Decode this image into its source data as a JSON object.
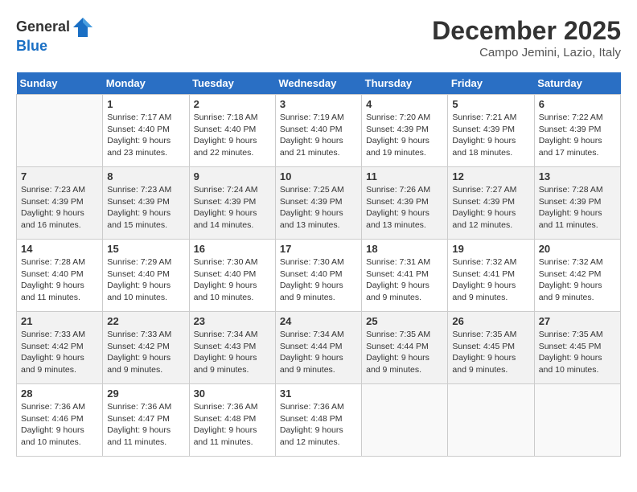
{
  "logo": {
    "general": "General",
    "blue": "Blue"
  },
  "title": "December 2025",
  "location": "Campo Jemini, Lazio, Italy",
  "days_of_week": [
    "Sunday",
    "Monday",
    "Tuesday",
    "Wednesday",
    "Thursday",
    "Friday",
    "Saturday"
  ],
  "weeks": [
    [
      {
        "day": "",
        "info": ""
      },
      {
        "day": "1",
        "info": "Sunrise: 7:17 AM\nSunset: 4:40 PM\nDaylight: 9 hours\nand 23 minutes."
      },
      {
        "day": "2",
        "info": "Sunrise: 7:18 AM\nSunset: 4:40 PM\nDaylight: 9 hours\nand 22 minutes."
      },
      {
        "day": "3",
        "info": "Sunrise: 7:19 AM\nSunset: 4:40 PM\nDaylight: 9 hours\nand 21 minutes."
      },
      {
        "day": "4",
        "info": "Sunrise: 7:20 AM\nSunset: 4:39 PM\nDaylight: 9 hours\nand 19 minutes."
      },
      {
        "day": "5",
        "info": "Sunrise: 7:21 AM\nSunset: 4:39 PM\nDaylight: 9 hours\nand 18 minutes."
      },
      {
        "day": "6",
        "info": "Sunrise: 7:22 AM\nSunset: 4:39 PM\nDaylight: 9 hours\nand 17 minutes."
      }
    ],
    [
      {
        "day": "7",
        "info": "Sunrise: 7:23 AM\nSunset: 4:39 PM\nDaylight: 9 hours\nand 16 minutes."
      },
      {
        "day": "8",
        "info": "Sunrise: 7:23 AM\nSunset: 4:39 PM\nDaylight: 9 hours\nand 15 minutes."
      },
      {
        "day": "9",
        "info": "Sunrise: 7:24 AM\nSunset: 4:39 PM\nDaylight: 9 hours\nand 14 minutes."
      },
      {
        "day": "10",
        "info": "Sunrise: 7:25 AM\nSunset: 4:39 PM\nDaylight: 9 hours\nand 13 minutes."
      },
      {
        "day": "11",
        "info": "Sunrise: 7:26 AM\nSunset: 4:39 PM\nDaylight: 9 hours\nand 13 minutes."
      },
      {
        "day": "12",
        "info": "Sunrise: 7:27 AM\nSunset: 4:39 PM\nDaylight: 9 hours\nand 12 minutes."
      },
      {
        "day": "13",
        "info": "Sunrise: 7:28 AM\nSunset: 4:39 PM\nDaylight: 9 hours\nand 11 minutes."
      }
    ],
    [
      {
        "day": "14",
        "info": "Sunrise: 7:28 AM\nSunset: 4:40 PM\nDaylight: 9 hours\nand 11 minutes."
      },
      {
        "day": "15",
        "info": "Sunrise: 7:29 AM\nSunset: 4:40 PM\nDaylight: 9 hours\nand 10 minutes."
      },
      {
        "day": "16",
        "info": "Sunrise: 7:30 AM\nSunset: 4:40 PM\nDaylight: 9 hours\nand 10 minutes."
      },
      {
        "day": "17",
        "info": "Sunrise: 7:30 AM\nSunset: 4:40 PM\nDaylight: 9 hours\nand 9 minutes."
      },
      {
        "day": "18",
        "info": "Sunrise: 7:31 AM\nSunset: 4:41 PM\nDaylight: 9 hours\nand 9 minutes."
      },
      {
        "day": "19",
        "info": "Sunrise: 7:32 AM\nSunset: 4:41 PM\nDaylight: 9 hours\nand 9 minutes."
      },
      {
        "day": "20",
        "info": "Sunrise: 7:32 AM\nSunset: 4:42 PM\nDaylight: 9 hours\nand 9 minutes."
      }
    ],
    [
      {
        "day": "21",
        "info": "Sunrise: 7:33 AM\nSunset: 4:42 PM\nDaylight: 9 hours\nand 9 minutes."
      },
      {
        "day": "22",
        "info": "Sunrise: 7:33 AM\nSunset: 4:42 PM\nDaylight: 9 hours\nand 9 minutes."
      },
      {
        "day": "23",
        "info": "Sunrise: 7:34 AM\nSunset: 4:43 PM\nDaylight: 9 hours\nand 9 minutes."
      },
      {
        "day": "24",
        "info": "Sunrise: 7:34 AM\nSunset: 4:44 PM\nDaylight: 9 hours\nand 9 minutes."
      },
      {
        "day": "25",
        "info": "Sunrise: 7:35 AM\nSunset: 4:44 PM\nDaylight: 9 hours\nand 9 minutes."
      },
      {
        "day": "26",
        "info": "Sunrise: 7:35 AM\nSunset: 4:45 PM\nDaylight: 9 hours\nand 9 minutes."
      },
      {
        "day": "27",
        "info": "Sunrise: 7:35 AM\nSunset: 4:45 PM\nDaylight: 9 hours\nand 10 minutes."
      }
    ],
    [
      {
        "day": "28",
        "info": "Sunrise: 7:36 AM\nSunset: 4:46 PM\nDaylight: 9 hours\nand 10 minutes."
      },
      {
        "day": "29",
        "info": "Sunrise: 7:36 AM\nSunset: 4:47 PM\nDaylight: 9 hours\nand 11 minutes."
      },
      {
        "day": "30",
        "info": "Sunrise: 7:36 AM\nSunset: 4:48 PM\nDaylight: 9 hours\nand 11 minutes."
      },
      {
        "day": "31",
        "info": "Sunrise: 7:36 AM\nSunset: 4:48 PM\nDaylight: 9 hours\nand 12 minutes."
      },
      {
        "day": "",
        "info": ""
      },
      {
        "day": "",
        "info": ""
      },
      {
        "day": "",
        "info": ""
      }
    ]
  ]
}
